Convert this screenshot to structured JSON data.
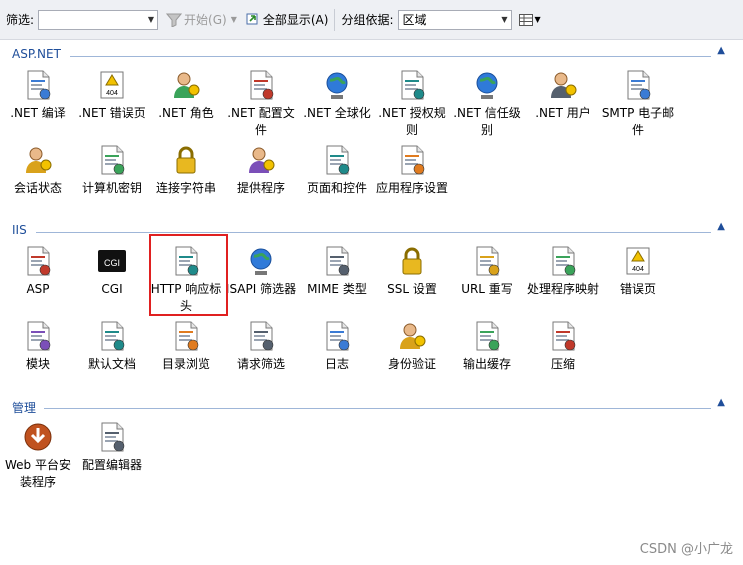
{
  "toolbar": {
    "filter_label": "筛选:",
    "filter_value": "",
    "start_label": "开始(G)",
    "showall_label": "全部显示(A)",
    "groupby_label": "分组依据:",
    "groupby_value": "区域"
  },
  "groups": [
    {
      "title": "ASP.NET",
      "items": [
        {
          "label": ".NET 编译",
          "icon": "net-compile-icon"
        },
        {
          "label": ".NET 错误页",
          "icon": "net-error-pages-icon"
        },
        {
          "label": ".NET 角色",
          "icon": "net-roles-icon"
        },
        {
          "label": ".NET 配置文件",
          "icon": "net-profile-icon"
        },
        {
          "label": ".NET 全球化",
          "icon": "net-globalization-icon"
        },
        {
          "label": ".NET 授权规则",
          "icon": "net-authorization-icon"
        },
        {
          "label": ".NET 信任级别",
          "icon": "net-trust-levels-icon"
        },
        {
          "label": ".NET 用户",
          "icon": "net-users-icon"
        },
        {
          "label": "SMTP 电子邮件",
          "icon": "smtp-email-icon"
        },
        {
          "label": "会话状态",
          "icon": "session-state-icon"
        },
        {
          "label": "计算机密钥",
          "icon": "machine-key-icon"
        },
        {
          "label": "连接字符串",
          "icon": "connection-strings-icon"
        },
        {
          "label": "提供程序",
          "icon": "providers-icon"
        },
        {
          "label": "页面和控件",
          "icon": "pages-controls-icon"
        },
        {
          "label": "应用程序设置",
          "icon": "app-settings-icon"
        }
      ]
    },
    {
      "title": "IIS",
      "items": [
        {
          "label": "ASP",
          "icon": "asp-icon"
        },
        {
          "label": "CGI",
          "icon": "cgi-icon"
        },
        {
          "label": "HTTP 响应标头",
          "icon": "http-response-headers-icon"
        },
        {
          "label": "ISAPI 筛选器",
          "icon": "isapi-filters-icon"
        },
        {
          "label": "MIME 类型",
          "icon": "mime-types-icon"
        },
        {
          "label": "SSL 设置",
          "icon": "ssl-settings-icon"
        },
        {
          "label": "URL 重写",
          "icon": "url-rewrite-icon"
        },
        {
          "label": "处理程序映射",
          "icon": "handler-mappings-icon"
        },
        {
          "label": "错误页",
          "icon": "error-pages-icon"
        },
        {
          "label": "模块",
          "icon": "modules-icon"
        },
        {
          "label": "默认文档",
          "icon": "default-document-icon"
        },
        {
          "label": "目录浏览",
          "icon": "directory-browsing-icon"
        },
        {
          "label": "请求筛选",
          "icon": "request-filtering-icon"
        },
        {
          "label": "日志",
          "icon": "logging-icon"
        },
        {
          "label": "身份验证",
          "icon": "authentication-icon"
        },
        {
          "label": "输出缓存",
          "icon": "output-caching-icon"
        },
        {
          "label": "压缩",
          "icon": "compression-icon"
        }
      ]
    },
    {
      "title": "管理",
      "items": [
        {
          "label": "Web 平台安装程序",
          "icon": "web-platform-installer-icon"
        },
        {
          "label": "配置编辑器",
          "icon": "configuration-editor-icon"
        }
      ]
    }
  ],
  "watermark": "CSDN @小广龙"
}
